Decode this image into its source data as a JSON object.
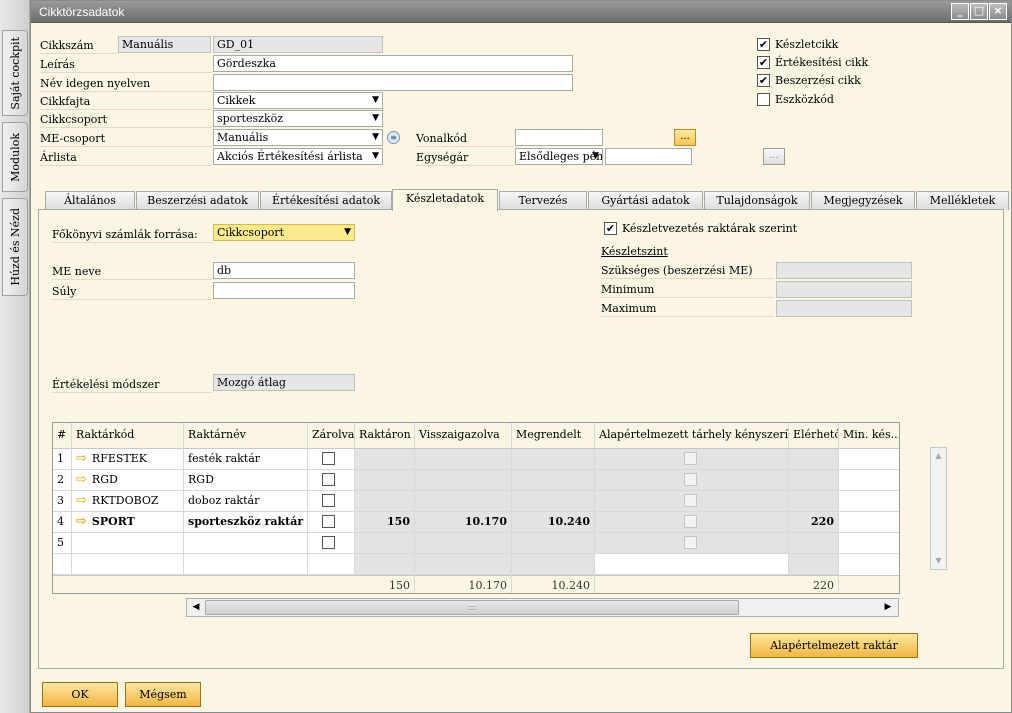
{
  "sidebar": {
    "tabs": [
      "Saját cockpit",
      "Modulok",
      "Húzd és Nézd"
    ]
  },
  "window": {
    "title": "Cikktörzsadatok",
    "controls": [
      "minimize",
      "restore",
      "close"
    ]
  },
  "header": {
    "item_no_label": "Cikkszám",
    "item_no_series": "Manuális",
    "item_no_value": "GD_01",
    "description_label": "Leírás",
    "description_value": "Gördeszka",
    "foreign_name_label": "Név idegen nyelven",
    "foreign_name_value": "",
    "item_type_label": "Cikkfajta",
    "item_type_value": "Cikkek",
    "item_group_label": "Cikkcsoport",
    "item_group_value": "sporteszköz",
    "uom_group_label": "ME-csoport",
    "uom_group_value": "Manuális",
    "price_list_label": "Árlista",
    "price_list_value": "Akciós Értékesítési árlista",
    "barcode_label": "Vonalkód",
    "barcode_value": "",
    "unit_price_label": "Egységár",
    "unit_price_currency": "Elsődleges pén:",
    "unit_price_value": "",
    "browse_btn": "...",
    "checkboxes": [
      {
        "label": "Készletcikk",
        "checked": true
      },
      {
        "label": "Értékesítési cikk",
        "checked": true
      },
      {
        "label": "Beszerzési cikk",
        "checked": true
      },
      {
        "label": "Eszközkód",
        "checked": false
      }
    ]
  },
  "tabs": [
    "Általános",
    "Beszerzési adatok",
    "Értékesítési adatok",
    "Készletadatok",
    "Tervezés",
    "Gyártási adatok",
    "Tulajdonságok",
    "Megjegyzések",
    "Mellékletek"
  ],
  "active_tab": "Készletadatok",
  "inventory": {
    "gl_source_label": "Főkönyvi számlák forrása:",
    "gl_source_value": "Cikkcsoport",
    "uom_name_label": "ME neve",
    "uom_name_value": "db",
    "weight_label": "Súly",
    "weight_value": "",
    "valuation_label": "Értékelési módszer",
    "valuation_value": "Mozgó átlag",
    "by_warehouse_label": "Készletvezetés raktárak szerint",
    "by_warehouse_checked": true,
    "level_title": "Készletszint",
    "required_label": "Szükséges (beszerzési ME)",
    "minimum_label": "Minimum",
    "maximum_label": "Maximum"
  },
  "grid": {
    "columns": [
      "#",
      "Raktárkód",
      "Raktárnév",
      "Zárolva",
      "Raktáron",
      "Visszaigazolva",
      "Megrendelt",
      "Alapértelmezett tárhely kényszerítése",
      "Elérhető",
      "Min. kés..."
    ],
    "rows": [
      {
        "no": "1",
        "code": "RFESTEK",
        "name": "festék raktár",
        "on_hand": "",
        "committed": "",
        "ordered": "",
        "available": "",
        "bold": false
      },
      {
        "no": "2",
        "code": "RGD",
        "name": "RGD",
        "on_hand": "",
        "committed": "",
        "ordered": "",
        "available": "",
        "bold": false
      },
      {
        "no": "3",
        "code": "RKTDOBOZ",
        "name": "doboz raktár",
        "on_hand": "",
        "committed": "",
        "ordered": "",
        "available": "",
        "bold": false
      },
      {
        "no": "4",
        "code": "SPORT",
        "name": "sporteszköz raktár",
        "on_hand": "150",
        "committed": "10.170",
        "ordered": "10.240",
        "available": "220",
        "bold": true
      },
      {
        "no": "5",
        "code": "",
        "name": "",
        "on_hand": "",
        "committed": "",
        "ordered": "",
        "available": "",
        "bold": false
      }
    ],
    "totals": {
      "on_hand": "150",
      "committed": "10.170",
      "ordered": "10.240",
      "available": "220"
    }
  },
  "default_wh_button": "Alapértelmezett raktár",
  "footer": {
    "ok": "OK",
    "cancel": "Mégsem"
  },
  "colors": {
    "window_bg": "#fbf6e3",
    "button_yellow": "#f0b743",
    "titlebar": "#7d7d7d"
  }
}
